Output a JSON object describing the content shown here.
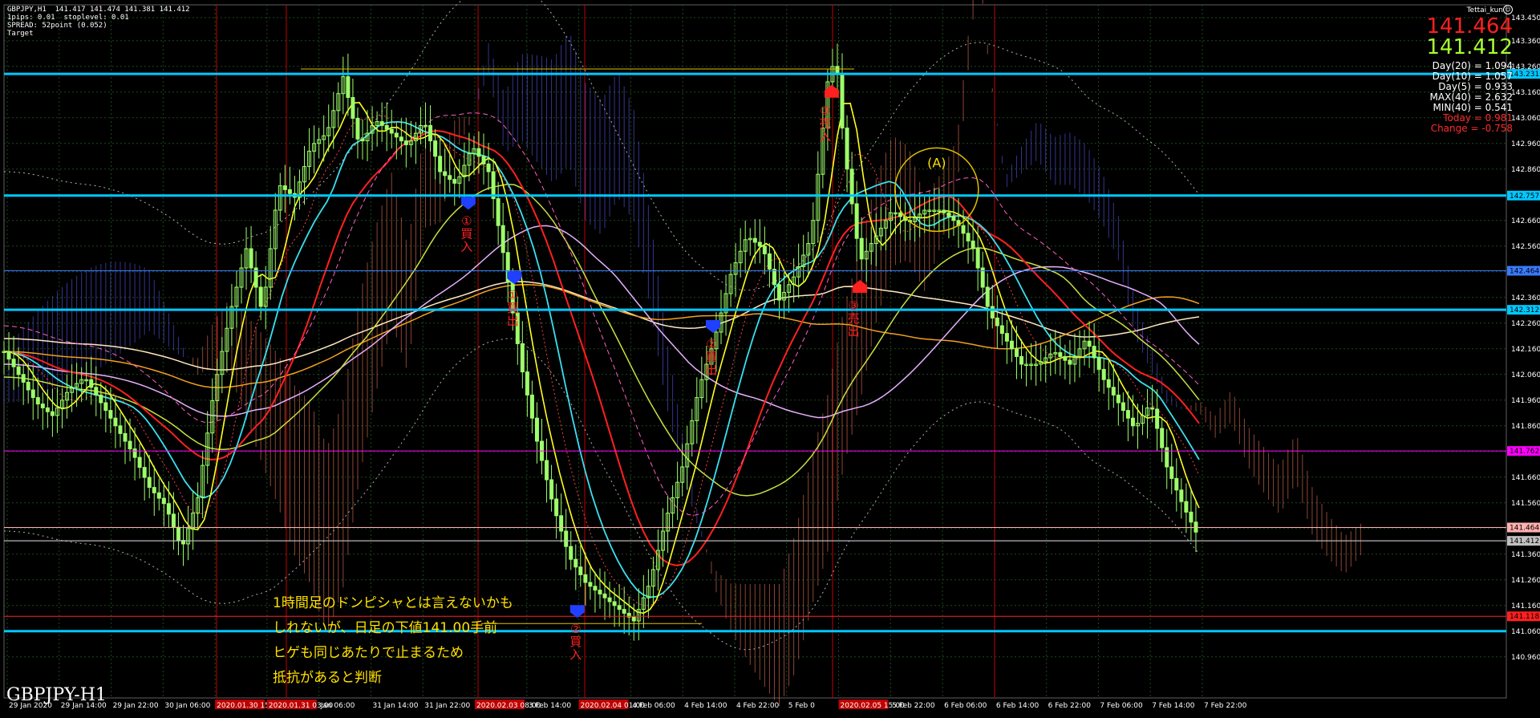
{
  "header": {
    "symbol_line": "GBPJPY,H1  141.417 141.474 141.381 141.412",
    "line2": "1pips: 0.01  stoplevel: 0.01",
    "line3": "SPREAD: 52point (0.052)",
    "line4": "Target"
  },
  "author": "Tettai_kun",
  "prices": {
    "bid": "141.464",
    "ask": "141.412"
  },
  "stats": [
    {
      "text": "Day(20) = 1.094",
      "color": "#ffffff"
    },
    {
      "text": "Day(10) = 1.057",
      "color": "#ffffff"
    },
    {
      "text": "Day(5) = 0.933",
      "color": "#ffffff"
    },
    {
      "text": "MAX(40) = 2.632",
      "color": "#ffffff"
    },
    {
      "text": "MIN(40) = 0.541",
      "color": "#ffffff"
    },
    {
      "text": "Today = 0.981",
      "color": "#ff2a2a"
    },
    {
      "text": "Change = -0.758",
      "color": "#ff2a2a"
    }
  ],
  "watermark": "GBPJPY-H1",
  "note_lines": [
    "1時間足のドンピシャとは言えないかも",
    "しれないが、日足の下値141.00手前",
    "ヒゲも同じあたりで止まるため",
    "抵抗があると判断"
  ],
  "colors": {
    "candle": "#9dff6a",
    "ma_red": "#ff2020",
    "ma_cyan": "#3ae0f0",
    "ma_yellow": "#ffff20",
    "ma_olive": "#c8e040",
    "ma_pink": "#e8b0ff",
    "ma_orange": "#f0a020",
    "ma_cream": "#ffe8c0",
    "hline_cyan": "#00c8ff",
    "hline_magenta": "#ff00ff",
    "hline_red": "#ff2020",
    "vline_red": "#c00000",
    "cloud_bear": "#ff8060",
    "cloud_bull": "#6060ff",
    "grid": "#1a4a1a"
  },
  "chart_data": {
    "type": "candlestick",
    "ylim": [
      140.8,
      143.5
    ],
    "y_ticks": [
      "143.450",
      "143.360",
      "143.260",
      "143.160",
      "143.060",
      "142.960",
      "142.860",
      "142.760",
      "142.660",
      "142.560",
      "142.460",
      "142.360",
      "142.260",
      "142.160",
      "142.060",
      "141.960",
      "141.860",
      "141.760",
      "141.660",
      "141.560",
      "141.460",
      "141.360",
      "141.260",
      "141.160",
      "141.060",
      "140.960"
    ],
    "x_labels": [
      {
        "text": "29 Jan 2020",
        "hl": false
      },
      {
        "text": "29 Jan 14:00",
        "hl": false
      },
      {
        "text": "29 Jan 22:00",
        "hl": false
      },
      {
        "text": "30 Jan 06:00",
        "hl": false
      },
      {
        "text": "2020.01.30 15:00",
        "hl": true
      },
      {
        "text": "2020.01.31 03:00",
        "hl": true
      },
      {
        "text": "Jan 06:00",
        "hl": false
      },
      {
        "text": "31 Jan 14:00",
        "hl": false
      },
      {
        "text": "31 Jan 22:00",
        "hl": false
      },
      {
        "text": "2020.02.03 08:00",
        "hl": true
      },
      {
        "text": "3 Feb 14:00",
        "hl": false
      },
      {
        "text": "2020.02.04 01:00",
        "hl": true
      },
      {
        "text": "4 Feb 06:00",
        "hl": false
      },
      {
        "text": "4 Feb 14:00",
        "hl": false
      },
      {
        "text": "4 Feb 22:00",
        "hl": false
      },
      {
        "text": "5 Feb 0",
        "hl": false
      },
      {
        "text": "2020.02.05 15:00",
        "hl": true
      },
      {
        "text": "5 Feb 22:00",
        "hl": false
      },
      {
        "text": "6 Feb 06:00",
        "hl": false
      },
      {
        "text": "6 Feb 14:00",
        "hl": false
      },
      {
        "text": "6 Feb 22:00",
        "hl": false
      },
      {
        "text": "7 Feb 06:00",
        "hl": false
      },
      {
        "text": "7 Feb 14:00",
        "hl": false
      },
      {
        "text": "7 Feb 22:00",
        "hl": false
      }
    ],
    "h_levels": [
      {
        "price": 143.231,
        "label": "143.231",
        "color": "#00c8ff",
        "thick": true
      },
      {
        "price": 142.757,
        "label": "142.757",
        "color": "#00c8ff",
        "thick": true
      },
      {
        "price": 142.464,
        "label": "142.464",
        "color": "#3a7aff",
        "thick": false
      },
      {
        "price": 142.312,
        "label": "142.312",
        "color": "#00c8ff",
        "thick": true
      },
      {
        "price": 141.762,
        "label": "141.762",
        "color": "#ff00ff",
        "thick": false
      },
      {
        "price": 141.464,
        "label": "141.464",
        "color": "#ffb0b0",
        "thick": false
      },
      {
        "price": 141.412,
        "label": "141.412",
        "color": "#c0c0c0",
        "thick": false
      },
      {
        "price": 141.118,
        "label": "141.118",
        "color": "#ff2020",
        "thick": false
      },
      {
        "price": 141.06,
        "label": "",
        "color": "#00c8ff",
        "thick": true
      }
    ],
    "price_path": [
      [
        0,
        142.15
      ],
      [
        20,
        142.05
      ],
      [
        40,
        141.95
      ],
      [
        60,
        141.9
      ],
      [
        80,
        142.0
      ],
      [
        100,
        142.05
      ],
      [
        120,
        141.95
      ],
      [
        140,
        141.85
      ],
      [
        160,
        141.75
      ],
      [
        180,
        141.62
      ],
      [
        200,
        141.55
      ],
      [
        220,
        141.38
      ],
      [
        240,
        141.58
      ],
      [
        260,
        142.0
      ],
      [
        280,
        142.3
      ],
      [
        300,
        142.55
      ],
      [
        320,
        142.3
      ],
      [
        340,
        142.8
      ],
      [
        360,
        142.75
      ],
      [
        380,
        142.95
      ],
      [
        400,
        143.0
      ],
      [
        420,
        143.22
      ],
      [
        440,
        142.95
      ],
      [
        460,
        143.05
      ],
      [
        480,
        143.0
      ],
      [
        500,
        142.95
      ],
      [
        520,
        143.05
      ],
      [
        540,
        142.85
      ],
      [
        560,
        142.8
      ],
      [
        580,
        142.95
      ],
      [
        600,
        142.85
      ],
      [
        620,
        142.5
      ],
      [
        640,
        142.1
      ],
      [
        660,
        141.8
      ],
      [
        680,
        141.55
      ],
      [
        700,
        141.35
      ],
      [
        720,
        141.25
      ],
      [
        740,
        141.2
      ],
      [
        760,
        141.15
      ],
      [
        780,
        141.1
      ],
      [
        800,
        141.25
      ],
      [
        820,
        141.5
      ],
      [
        840,
        141.7
      ],
      [
        860,
        142.0
      ],
      [
        880,
        142.2
      ],
      [
        900,
        142.45
      ],
      [
        920,
        142.6
      ],
      [
        940,
        142.55
      ],
      [
        960,
        142.35
      ],
      [
        980,
        142.45
      ],
      [
        1000,
        142.6
      ],
      [
        1020,
        143.2
      ],
      [
        1030,
        143.3
      ],
      [
        1040,
        142.95
      ],
      [
        1060,
        142.5
      ],
      [
        1080,
        142.6
      ],
      [
        1100,
        142.7
      ],
      [
        1120,
        142.65
      ],
      [
        1140,
        142.7
      ],
      [
        1160,
        142.7
      ],
      [
        1180,
        142.65
      ],
      [
        1200,
        142.55
      ],
      [
        1220,
        142.3
      ],
      [
        1240,
        142.2
      ],
      [
        1260,
        142.1
      ],
      [
        1280,
        142.1
      ],
      [
        1300,
        142.15
      ],
      [
        1320,
        142.1
      ],
      [
        1340,
        142.2
      ],
      [
        1360,
        142.05
      ],
      [
        1380,
        141.95
      ],
      [
        1400,
        141.85
      ],
      [
        1420,
        141.95
      ],
      [
        1440,
        141.7
      ],
      [
        1460,
        141.55
      ],
      [
        1480,
        141.42
      ]
    ],
    "signals": [
      {
        "x": 575,
        "price": 142.73,
        "color": "#2040ff",
        "shape": "down",
        "label": "①買入"
      },
      {
        "x": 632,
        "price": 142.44,
        "color": "#2040ff",
        "shape": "down",
        "label": "①買出"
      },
      {
        "x": 878,
        "price": 142.25,
        "color": "#2040ff",
        "shape": "down",
        "label": "②買出"
      },
      {
        "x": 710,
        "price": 141.14,
        "color": "#2040ff",
        "shape": "down",
        "label": "②買入"
      },
      {
        "x": 1025,
        "price": 143.16,
        "color": "#ff2020",
        "shape": "up",
        "label": "③売入"
      },
      {
        "x": 1060,
        "price": 142.4,
        "color": "#ff2020",
        "shape": "up",
        "label": "③売出"
      }
    ],
    "circle_label": "(A)"
  }
}
